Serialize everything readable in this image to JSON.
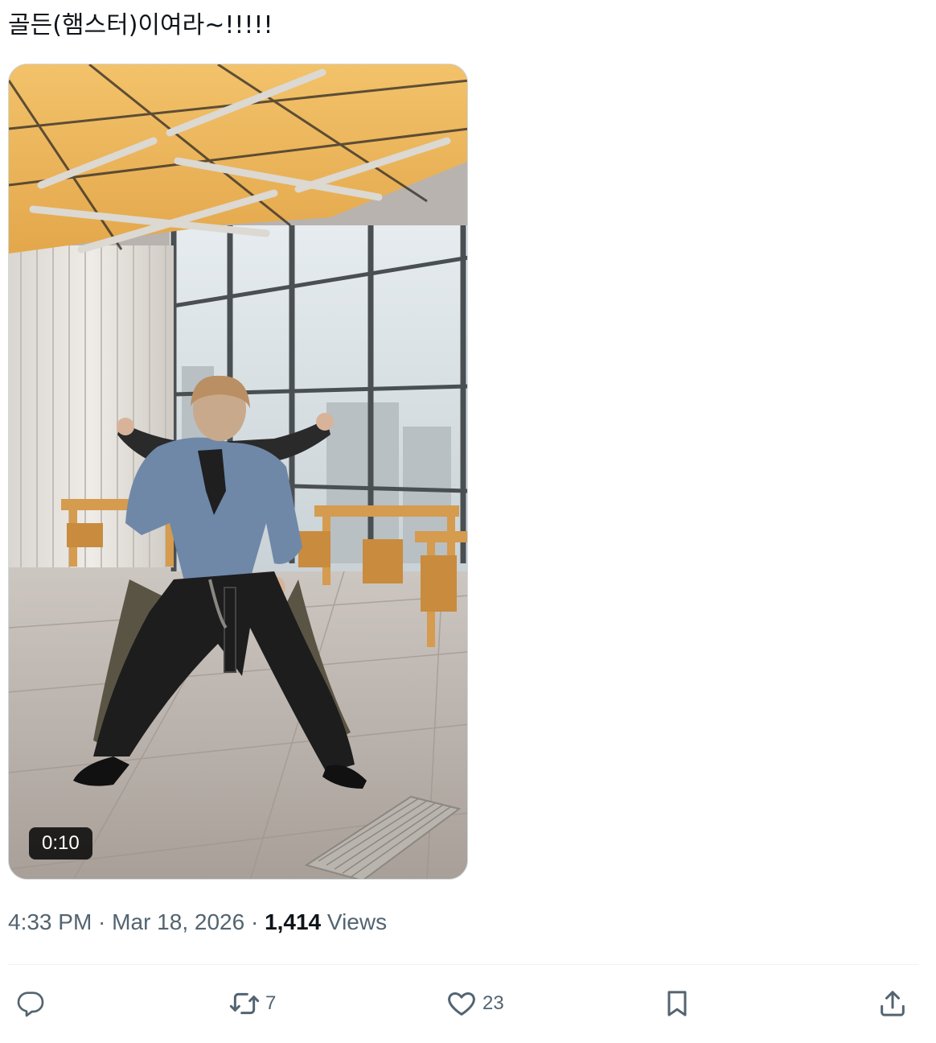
{
  "tweet": {
    "text": "골든(햄스터)이여라~!!!!!"
  },
  "media": {
    "type": "video",
    "duration": "0:10"
  },
  "meta": {
    "time": "4:33 PM",
    "separator1": " · ",
    "date": "Mar 18, 2026",
    "separator2": " · ",
    "views_count": "1,414",
    "views_label": " Views"
  },
  "actions": {
    "reply": {
      "icon": "reply-icon",
      "count": ""
    },
    "retweet": {
      "icon": "retweet-icon",
      "count": "7"
    },
    "like": {
      "icon": "heart-icon",
      "count": "23"
    },
    "bookmark": {
      "icon": "bookmark-icon",
      "count": ""
    },
    "share": {
      "icon": "share-icon",
      "count": ""
    }
  },
  "colors": {
    "text_primary": "#0f1419",
    "text_secondary": "#536471",
    "border": "#cfd9de",
    "divider": "#eff3f4"
  }
}
